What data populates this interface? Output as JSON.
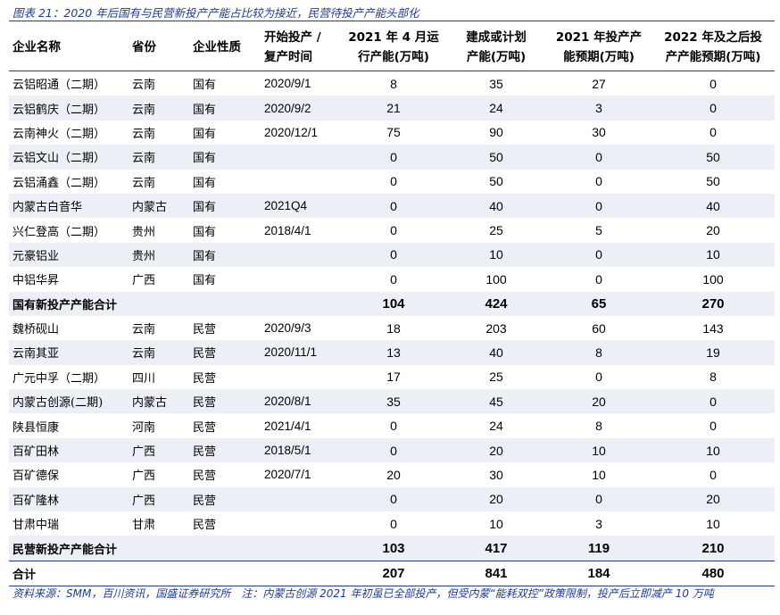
{
  "title": "图表 21：2020 年后国有与民营新投产产能占比较为接近，民营待投产产能头部化",
  "headers": {
    "company": "企业名称",
    "province": "省份",
    "nature": "企业性质",
    "start_line1": "开始投产 /",
    "start_line2": "复产时间",
    "run_line1": "2021 年 4 月运",
    "run_line2": "行产能(万吨)",
    "built_line1": "建成或计划",
    "built_line2": "产能(万吨)",
    "exp2021_line1": "2021 年投产产",
    "exp2021_line2": "能预期(万吨)",
    "exp2022_line1": "2022 年及之后投",
    "exp2022_line2": "产产能预期(万吨)"
  },
  "rows": [
    {
      "company": "云铝昭通（二期）",
      "province": "云南",
      "nature": "国有",
      "start": "2020/9/1",
      "run": "8",
      "built": "35",
      "exp2021": "27",
      "exp2022": "0"
    },
    {
      "company": "云铝鹤庆（二期）",
      "province": "云南",
      "nature": "国有",
      "start": "2020/9/2",
      "run": "21",
      "built": "24",
      "exp2021": "3",
      "exp2022": "0"
    },
    {
      "company": "云南神火（二期）",
      "province": "云南",
      "nature": "国有",
      "start": "2020/12/1",
      "run": "75",
      "built": "90",
      "exp2021": "30",
      "exp2022": "0"
    },
    {
      "company": "云铝文山（二期）",
      "province": "云南",
      "nature": "国有",
      "start": "",
      "run": "0",
      "built": "50",
      "exp2021": "0",
      "exp2022": "50"
    },
    {
      "company": "云铝涌鑫（二期）",
      "province": "云南",
      "nature": "国有",
      "start": "",
      "run": "0",
      "built": "50",
      "exp2021": "0",
      "exp2022": "50"
    },
    {
      "company": "内蒙古白音华",
      "province": "内蒙古",
      "nature": "国有",
      "start": "2021Q4",
      "run": "0",
      "built": "40",
      "exp2021": "0",
      "exp2022": "40"
    },
    {
      "company": "兴仁登高（二期）",
      "province": "贵州",
      "nature": "国有",
      "start": "2018/4/1",
      "run": "0",
      "built": "25",
      "exp2021": "5",
      "exp2022": "20"
    },
    {
      "company": "元豪铝业",
      "province": "贵州",
      "nature": "国有",
      "start": "",
      "run": "0",
      "built": "10",
      "exp2021": "0",
      "exp2022": "10"
    },
    {
      "company": "中铝华昇",
      "province": "广西",
      "nature": "国有",
      "start": "",
      "run": "0",
      "built": "100",
      "exp2021": "0",
      "exp2022": "100"
    },
    {
      "company": "国有新投产产能合计",
      "province": "",
      "nature": "",
      "start": "",
      "run": "104",
      "built": "424",
      "exp2021": "65",
      "exp2022": "270"
    },
    {
      "company": "魏桥砚山",
      "province": "云南",
      "nature": "民营",
      "start": "2020/9/3",
      "run": "18",
      "built": "203",
      "exp2021": "60",
      "exp2022": "143"
    },
    {
      "company": "云南其亚",
      "province": "云南",
      "nature": "民营",
      "start": "2020/11/1",
      "run": "13",
      "built": "40",
      "exp2021": "8",
      "exp2022": "19"
    },
    {
      "company": "广元中孚（二期）",
      "province": "四川",
      "nature": "民营",
      "start": "",
      "run": "17",
      "built": "25",
      "exp2021": "0",
      "exp2022": "8"
    },
    {
      "company": "内蒙古创源(二期)",
      "province": "内蒙古",
      "nature": "民营",
      "start": "2020/8/1",
      "run": "35",
      "built": "45",
      "exp2021": "20",
      "exp2022": "0"
    },
    {
      "company": "陕县恒康",
      "province": "河南",
      "nature": "民营",
      "start": "2021/4/1",
      "run": "0",
      "built": "24",
      "exp2021": "8",
      "exp2022": "0"
    },
    {
      "company": "百矿田林",
      "province": "广西",
      "nature": "民营",
      "start": "2018/5/1",
      "run": "0",
      "built": "20",
      "exp2021": "10",
      "exp2022": "10"
    },
    {
      "company": "百矿德保",
      "province": "广西",
      "nature": "民营",
      "start": "2020/7/1",
      "run": "20",
      "built": "30",
      "exp2021": "10",
      "exp2022": "0"
    },
    {
      "company": "百矿隆林",
      "province": "广西",
      "nature": "民营",
      "start": "",
      "run": "0",
      "built": "20",
      "exp2021": "0",
      "exp2022": "20"
    },
    {
      "company": "甘肃中瑞",
      "province": "甘肃",
      "nature": "民营",
      "start": "",
      "run": "0",
      "built": "10",
      "exp2021": "3",
      "exp2022": "10"
    },
    {
      "company": "民营新投产产能合计",
      "province": "",
      "nature": "",
      "start": "",
      "run": "103",
      "built": "417",
      "exp2021": "119",
      "exp2022": "210"
    },
    {
      "company": "合计",
      "province": "",
      "nature": "",
      "start": "",
      "run": "207",
      "built": "841",
      "exp2021": "184",
      "exp2022": "480"
    }
  ],
  "footer": "资料来源：SMM，百川资讯，国盛证券研究所　注：内蒙古创源 2021 年初虽已全部投产，但受内蒙“能耗双控”政策限制，投产后立即减产 10 万吨"
}
